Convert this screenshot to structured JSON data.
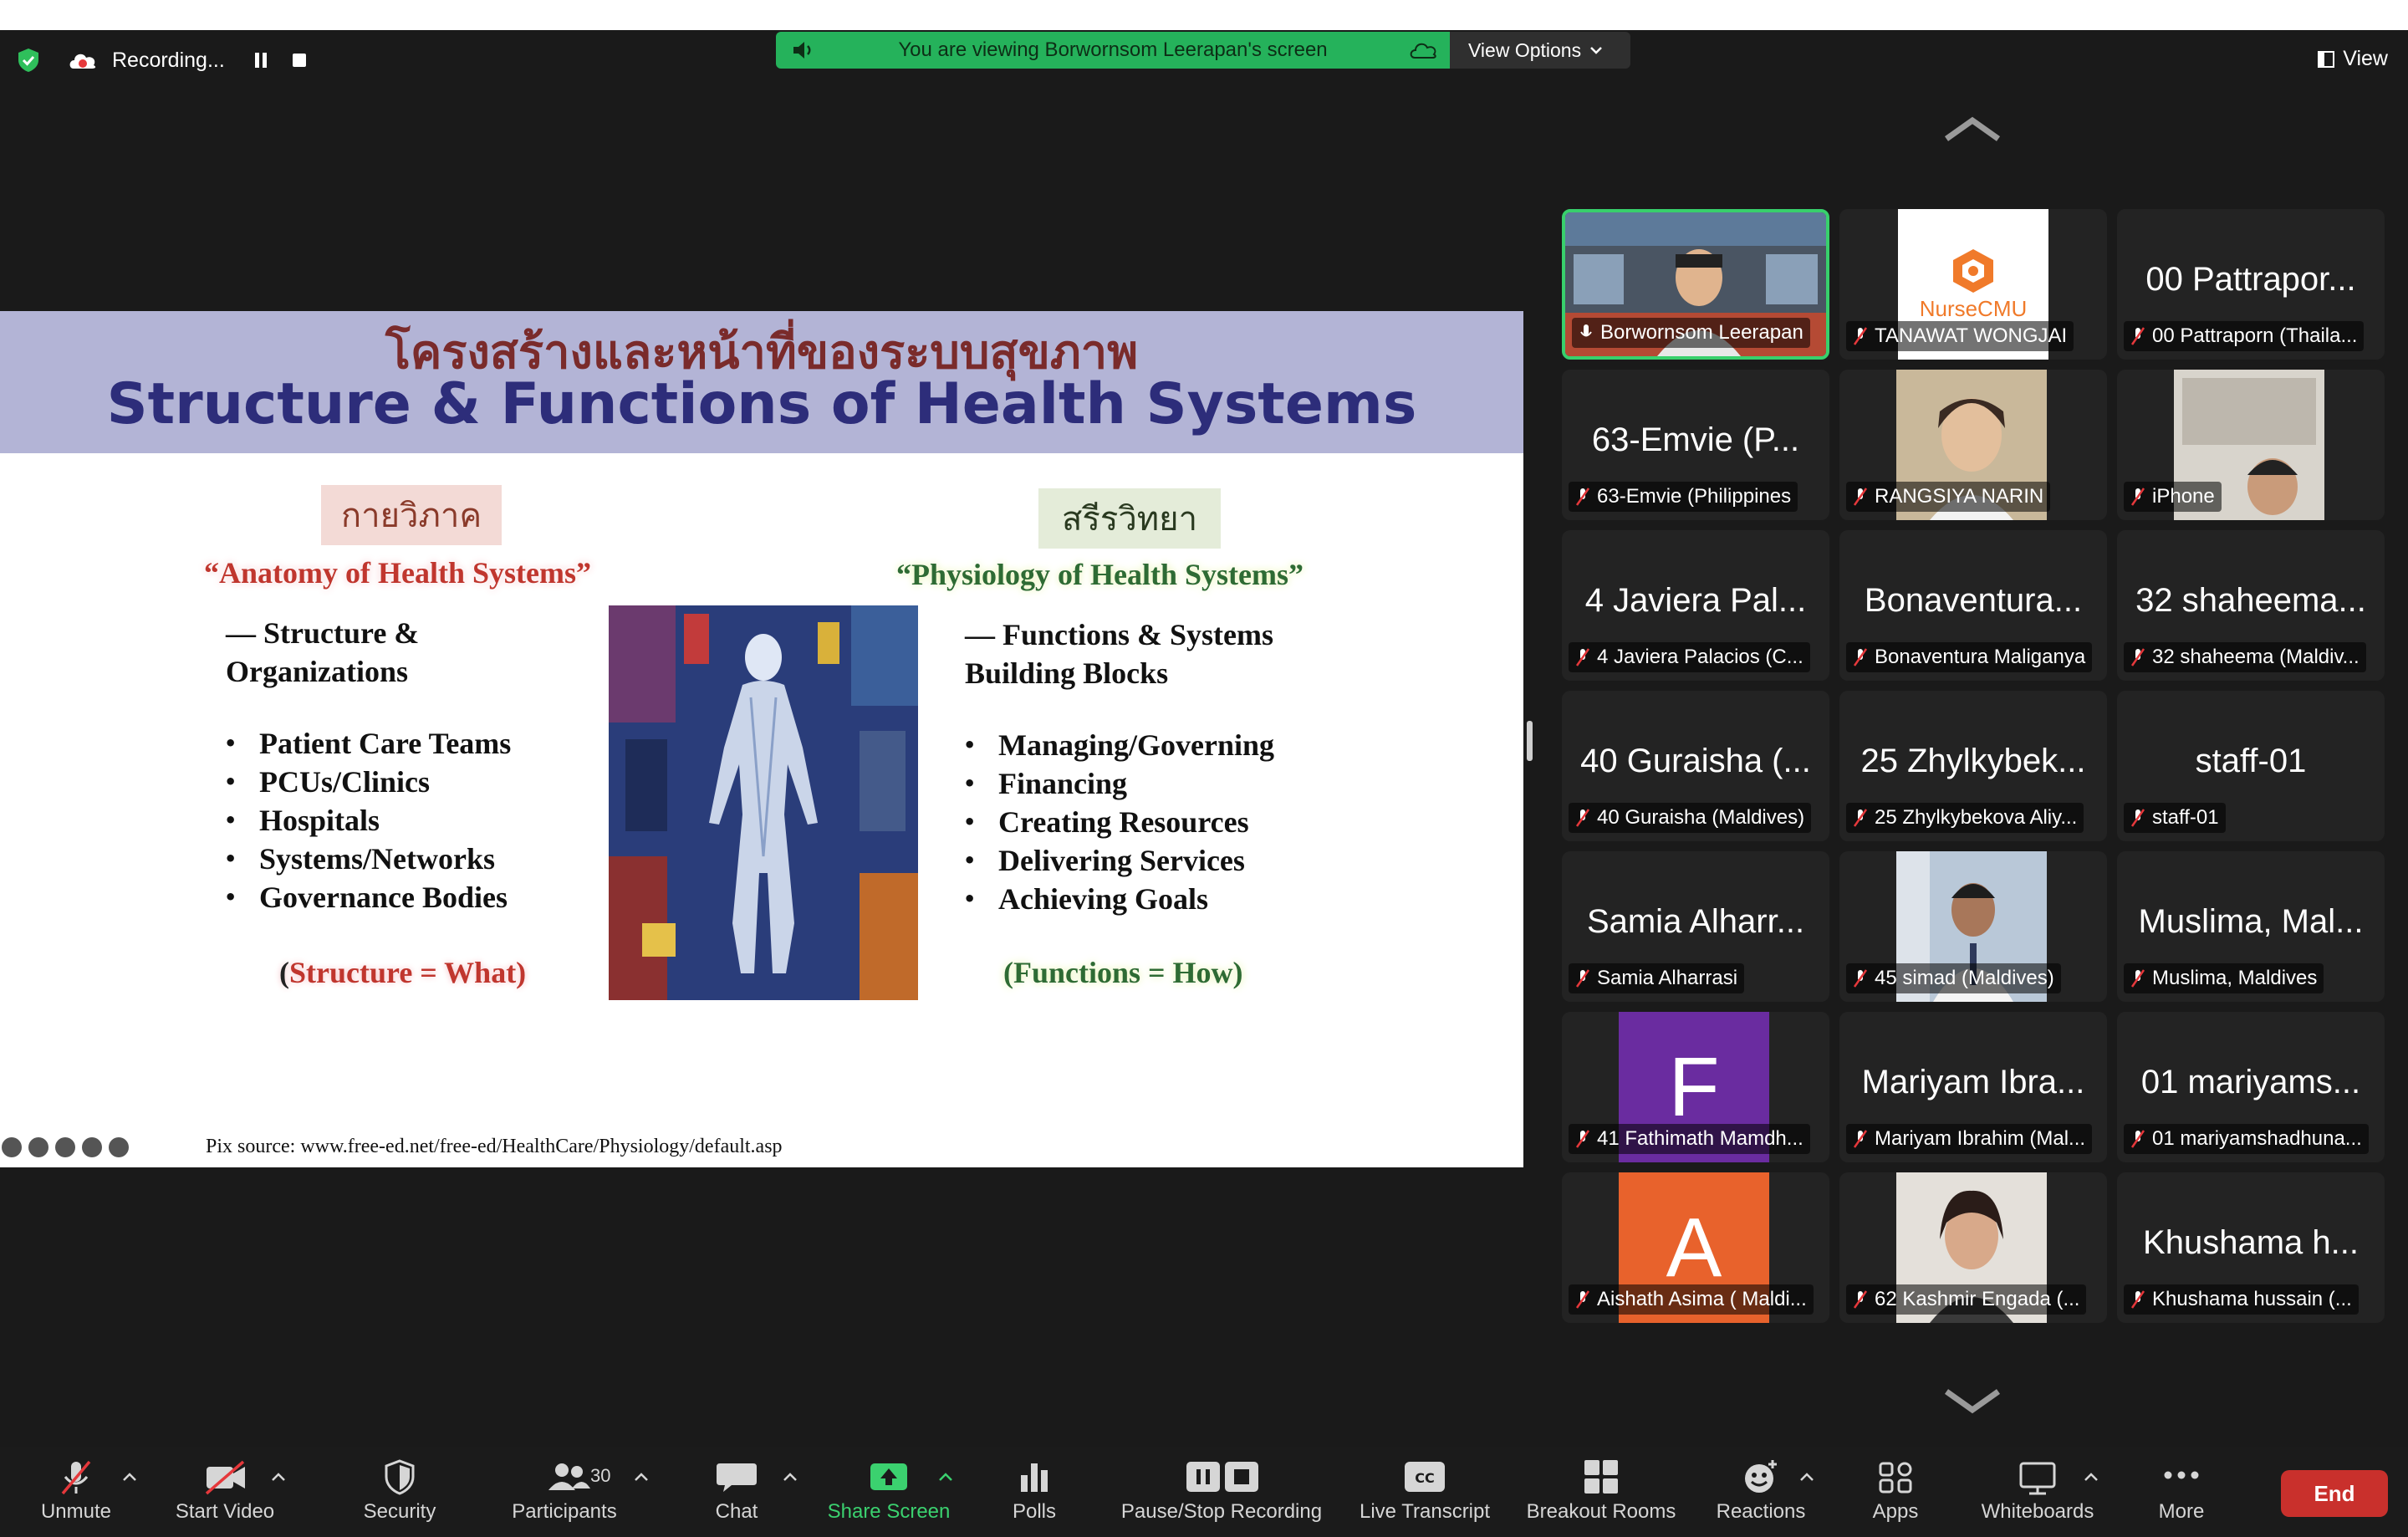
{
  "topbar": {
    "recording_label": "Recording...",
    "banner_text": "You are viewing Borwornsom Leerapan's screen",
    "view_options_label": "View Options",
    "view_label": "View"
  },
  "slide": {
    "thai_title": "โครงสร้างและหน้าที่ของระบบสุขภาพ",
    "english_title": "Structure & Functions of Health Systems",
    "left": {
      "thai_label": "กายวิภาค",
      "quote": "“Anatomy of Health Systems”",
      "subtitle_line1": "— Structure &",
      "subtitle_line2": "Organizations",
      "bullets": [
        "Patient Care Teams",
        "PCUs/Clinics",
        "Hospitals",
        "Systems/Networks",
        "Governance Bodies"
      ],
      "equation_open": "(",
      "equation": "Structure = What)"
    },
    "right": {
      "thai_label": "สรีรวิทยา",
      "quote": "“Physiology of Health Systems”",
      "subtitle_line1": "— Functions & Systems",
      "subtitle_line2": "Building Blocks",
      "bullets": [
        "Managing/Governing",
        "Financing",
        "Creating Resources",
        "Delivering Services",
        "Achieving Goals"
      ],
      "equation": "(Functions = How)"
    },
    "pix_source": "Pix source: www.free-ed.net/free-ed/HealthCare/Physiology/default.asp"
  },
  "gallery": {
    "tiles": [
      {
        "big": "",
        "caption": "Borwornsom Leerapan",
        "kind": "video"
      },
      {
        "big": "",
        "caption": "TANAWAT WONGJAI",
        "kind": "logo",
        "logo_text": "NurseCMU"
      },
      {
        "big": "00 Pattrapor...",
        "caption": "00 Pattraporn (Thaila...",
        "kind": "name"
      },
      {
        "big": "63-Emvie (P...",
        "caption": "63-Emvie (Philippines",
        "kind": "name"
      },
      {
        "big": "",
        "caption": "RANGSIYA NARIN",
        "kind": "photo"
      },
      {
        "big": "",
        "caption": "iPhone",
        "kind": "video"
      },
      {
        "big": "4 Javiera Pal...",
        "caption": "4 Javiera Palacios (C...",
        "kind": "name"
      },
      {
        "big": "Bonaventura...",
        "caption": "Bonaventura Maliganya",
        "kind": "name"
      },
      {
        "big": "32 shaheema...",
        "caption": "32 shaheema (Maldiv...",
        "kind": "name"
      },
      {
        "big": "40 Guraisha (...",
        "caption": "40 Guraisha (Maldives)",
        "kind": "name"
      },
      {
        "big": "25 Zhylkybek...",
        "caption": "25 Zhylkybekova Aliy...",
        "kind": "name"
      },
      {
        "big": "staff-01",
        "caption": "staff-01",
        "kind": "name"
      },
      {
        "big": "Samia Alharr...",
        "caption": "Samia Alharrasi",
        "kind": "name"
      },
      {
        "big": "",
        "caption": "45 simad (Maldives)",
        "kind": "photo"
      },
      {
        "big": "Muslima, Mal...",
        "caption": "Muslima, Maldives",
        "kind": "name"
      },
      {
        "big": "",
        "caption": "41 Fathimath Mamdh...",
        "kind": "letter",
        "letter": "F",
        "color": "#6a2ca0"
      },
      {
        "big": "Mariyam Ibra...",
        "caption": "Mariyam Ibrahim (Mal...",
        "kind": "name"
      },
      {
        "big": "01 mariyams...",
        "caption": "01 mariyamshadhuna...",
        "kind": "name"
      },
      {
        "big": "",
        "caption": "Aishath Asima ( Maldi...",
        "kind": "letter",
        "letter": "A",
        "color": "#e8622c"
      },
      {
        "big": "",
        "caption": "62 Kashmir Engada (...",
        "kind": "photo"
      },
      {
        "big": "Khushama h...",
        "caption": "Khushama hussain (...",
        "kind": "name"
      }
    ]
  },
  "toolbar": {
    "unmute": "Unmute",
    "start_video": "Start Video",
    "security": "Security",
    "participants": "Participants",
    "participants_count": "30",
    "chat": "Chat",
    "share_screen": "Share Screen",
    "polls": "Polls",
    "pause_stop_recording": "Pause/Stop Recording",
    "live_transcript": "Live Transcript",
    "live_transcript_icon_text": "CC",
    "breakout_rooms": "Breakout Rooms",
    "reactions": "Reactions",
    "apps": "Apps",
    "whiteboards": "Whiteboards",
    "more": "More",
    "end": "End"
  },
  "colors": {
    "banner_green": "#25b25b",
    "active_speaker_border": "#38d06c",
    "end_button": "#c9302c",
    "share_screen_green": "#3bd16f"
  }
}
